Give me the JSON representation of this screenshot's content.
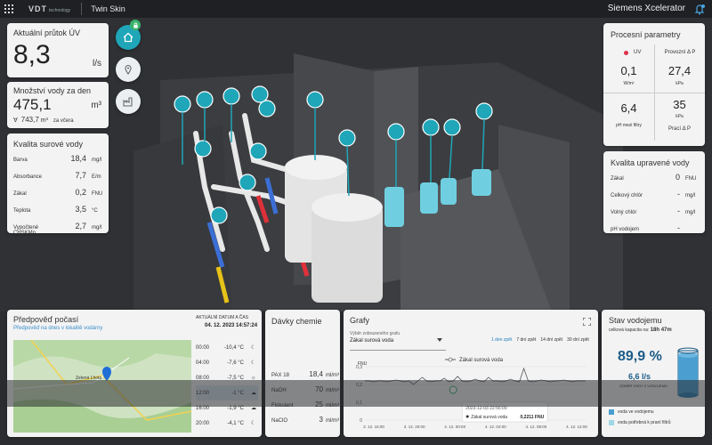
{
  "topbar": {
    "logo": "VDT",
    "logo_sub": "technology",
    "app_name": "Twin Skin",
    "platform": "Siemens Xcelerator"
  },
  "flow": {
    "title": "Aktuální průtok ÚV",
    "value": "8,3",
    "unit": "l/s"
  },
  "daily": {
    "title": "Množství vody za den",
    "value": "475,1",
    "unit": "m³",
    "prev_prefix": "∀",
    "prev_value": "743,7",
    "prev_unit": "m³",
    "prev_label": "za včera"
  },
  "raw": {
    "title": "Kvalita surové vody",
    "rows": [
      {
        "name": "Barva",
        "value": "18,4",
        "unit": "mg/l"
      },
      {
        "name": "Absorbance",
        "value": "7,7",
        "unit": "E/m"
      },
      {
        "name": "Zákal",
        "value": "0,2",
        "unit": "FNU"
      },
      {
        "name": "Teplota",
        "value": "3,5",
        "unit": "°C"
      },
      {
        "name": "Vypočtené CHSKMn",
        "value": "2,7",
        "unit": "mg/l"
      }
    ]
  },
  "process": {
    "title": "Procesní parametry",
    "uv_label": "UV",
    "uv_status_color": "#e0304a",
    "dp_label": "Provozní Δ P",
    "uv_value": "0,1",
    "uv_unit": "W/m²",
    "dp_value": "27,4",
    "dp_unit": "kPa",
    "filter_value": "6,4",
    "filter_unit": "pH mezi filtry",
    "wash_value": "35",
    "wash_unit": "kPa",
    "wash_label": "Prací Δ P"
  },
  "treated": {
    "title": "Kvalita upravené vody",
    "rows": [
      {
        "name": "Zákal",
        "value": "0",
        "unit": "FNU"
      },
      {
        "name": "Celkový chlór",
        "value": "-",
        "unit": "mg/l"
      },
      {
        "name": "Volný chlór",
        "value": "-",
        "unit": "mg/l"
      },
      {
        "name": "pH vodojem",
        "value": "-",
        "unit": ""
      }
    ]
  },
  "weather": {
    "title": "Předpověď počasí",
    "subtitle": "Předpověď na dnes v lokalitě vodárny",
    "date_label": "AKTUÁLNÍ DATUM A ČAS",
    "date_value": "04. 12. 2023 14:57:24",
    "rows": [
      {
        "time": "00:00",
        "temp": "-10,4 °C",
        "icon": "moon-icon"
      },
      {
        "time": "04:00",
        "temp": "-7,6 °C",
        "icon": "moon-icon"
      },
      {
        "time": "08:00",
        "temp": "-7,5 °C",
        "icon": "sun-icon"
      },
      {
        "time": "12:00",
        "temp": "-1 °C",
        "icon": "cloud-icon"
      },
      {
        "time": "16:00",
        "temp": "-1,9 °C",
        "icon": "cloud-icon"
      },
      {
        "time": "20:00",
        "temp": "-4,1 °C",
        "icon": "moon-icon"
      }
    ]
  },
  "dosing": {
    "title": "Dávky chemie",
    "rows": [
      {
        "name": "PAX 18",
        "value": "18,4",
        "unit": "ml/m³"
      },
      {
        "name": "NaOH",
        "value": "70",
        "unit": "ml/m³"
      },
      {
        "name": "Flokulant",
        "value": "25",
        "unit": "ml/m³"
      },
      {
        "name": "NaClO",
        "value": "3",
        "unit": "ml/m³"
      }
    ]
  },
  "graphs": {
    "title": "Grafy",
    "select_label": "Výběr zobrazeného grafu",
    "select_value": "Zákal surová voda",
    "tabs": [
      "1 den zpět",
      "7 dní zpět",
      "14 dní zpět",
      "30 dní zpět"
    ],
    "active_tab": 0,
    "legend": "Zákal surová voda"
  },
  "chart_data": {
    "type": "line",
    "title": "Zákal surová voda",
    "ylabel": "FNU",
    "ylim": [
      0,
      0.3
    ],
    "yticks": [
      "0,3",
      "0,2",
      "0,1",
      "0"
    ],
    "xticks": [
      "3. 12. 16:00",
      "3. 12. 20:00",
      "4. 12. 00:00",
      "4. 12. 04:00",
      "4. 12. 08:00",
      "4. 12. 12:00"
    ],
    "series": [
      {
        "name": "Zákal surová voda",
        "x": [
          0,
          0.02,
          0.04,
          0.06,
          0.08,
          0.1,
          0.12,
          0.14,
          0.16,
          0.18,
          0.2,
          0.22,
          0.24,
          0.26,
          0.28,
          0.3,
          0.32,
          0.34,
          0.36,
          0.38,
          0.4,
          0.42,
          0.44,
          0.46,
          0.48,
          0.5,
          0.52,
          0.54,
          0.56,
          0.58,
          0.6,
          0.62,
          0.64,
          0.66,
          0.68,
          0.7,
          0.72,
          0.74,
          0.76,
          0.78,
          0.8,
          0.82,
          0.84,
          0.86,
          0.88,
          0.9,
          0.92,
          0.94,
          0.96,
          0.98,
          1
        ],
        "values": [
          0.22,
          0.22,
          0.215,
          0.22,
          0.22,
          0.215,
          0.22,
          0.225,
          0.22,
          0.215,
          0.22,
          0.2,
          0.22,
          0.24,
          0.22,
          0.215,
          0.22,
          0.22,
          0.235,
          0.215,
          0.22,
          0.245,
          0.22,
          0.215,
          0.22,
          0.23,
          0.22,
          0.215,
          0.24,
          0.22,
          0.22,
          0.215,
          0.22,
          0.23,
          0.22,
          0.215,
          0.29,
          0.22,
          0.215,
          0.22,
          0.225,
          0.22,
          0.215,
          0.22,
          0.22,
          0.225,
          0.22,
          0.215,
          0.22,
          0.22,
          0.22
        ]
      }
    ],
    "tooltip": {
      "time": "2023-12-03 22:56:00",
      "series": "Zákal surová voda",
      "value": "0,2211 FNU"
    }
  },
  "reservoir": {
    "title": "Stav vodojemu",
    "capacity_label": "celková kapacita na:",
    "capacity_value": "18h 47m",
    "percent": "89,9 %",
    "fill": 0.899,
    "volume": "6,6 l/s",
    "volume_label": "ODBĚR VODY Z VODOJEMU",
    "legend1": "voda ve vodojemu",
    "legend2": "voda potřebná k praní filtrů",
    "water_color": "#4a9fd0",
    "accent": "#1fa6b8"
  }
}
